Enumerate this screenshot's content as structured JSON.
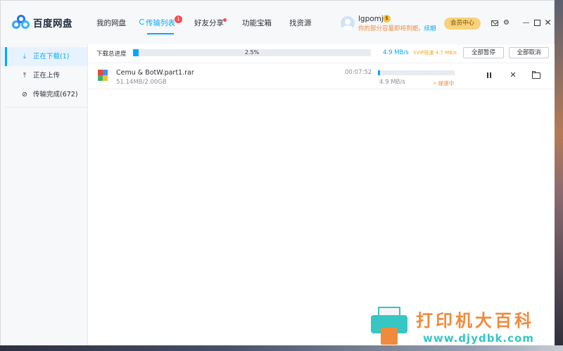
{
  "app": {
    "name": "百度网盘"
  },
  "nav": {
    "items": [
      {
        "label": "我的网盘"
      },
      {
        "label": "传输列表",
        "badge": "1"
      },
      {
        "label": "好友分享"
      },
      {
        "label": "功能宝箱"
      },
      {
        "label": "找资源"
      }
    ]
  },
  "user": {
    "name": "lgpomj",
    "coin": "$",
    "warning": "你的部分容量即将到期，",
    "renew": "续期",
    "vip_button": "会员中心"
  },
  "sidebar": {
    "items": [
      {
        "label": "正在下载(1)",
        "icon": "download-icon"
      },
      {
        "label": "正在上传",
        "icon": "upload-icon"
      },
      {
        "label": "传输完成(672)",
        "icon": "check-circle-icon"
      }
    ]
  },
  "toolbar": {
    "total_label": "下载总进度",
    "total_percent_text": "2.5%",
    "total_percent": 2.5,
    "speed": "4.9 MB/s",
    "svip_speed": "SVIP极速 4.7 MB/s",
    "pause_all": "全部暂停",
    "cancel_all": "全部取消"
  },
  "downloads": [
    {
      "name": "Cemu & BotW.part1.rar",
      "size": "51.14MB/2.00GB",
      "time": "00:07:52",
      "progress": 2.5,
      "speed": "4.9 MB/s",
      "accel": "提速中"
    }
  ],
  "watermark": {
    "line1": "打印机大百科",
    "line2": "www.djydbk.com"
  },
  "colors": {
    "accent": "#06a7ff",
    "badge": "#fa4b4b",
    "vip_gold": "#f8d27a",
    "warn_orange": "#f08a3c"
  }
}
